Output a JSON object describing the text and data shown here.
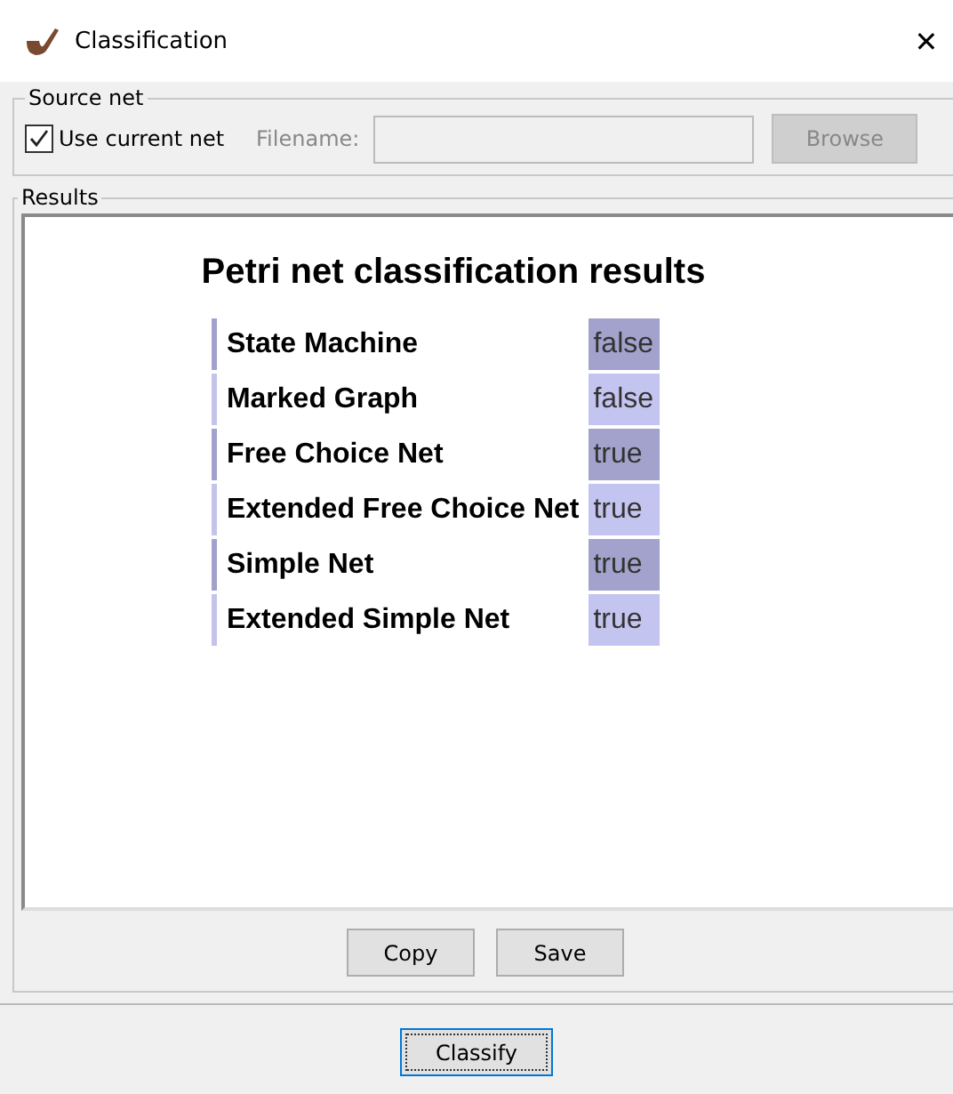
{
  "window": {
    "title": "Classification",
    "close": "✕"
  },
  "source_net": {
    "legend": "Source net",
    "use_current": {
      "label": "Use current net",
      "checked": true
    },
    "filename": {
      "label": "Filename:",
      "disabled": true
    },
    "browse": {
      "label": "Browse",
      "disabled": true
    }
  },
  "results": {
    "legend": "Results",
    "heading": "Petri net classification results",
    "rows": [
      {
        "name": "State Machine",
        "value": "false"
      },
      {
        "name": "Marked Graph",
        "value": "false"
      },
      {
        "name": "Free Choice Net",
        "value": "true"
      },
      {
        "name": "Extended Free Choice Net",
        "value": "true"
      },
      {
        "name": "Simple Net",
        "value": "true"
      },
      {
        "name": "Extended Simple Net",
        "value": "true"
      }
    ],
    "buttons": [
      "Copy",
      "Save"
    ]
  },
  "classify": {
    "label": "Classify",
    "focused": true
  }
}
